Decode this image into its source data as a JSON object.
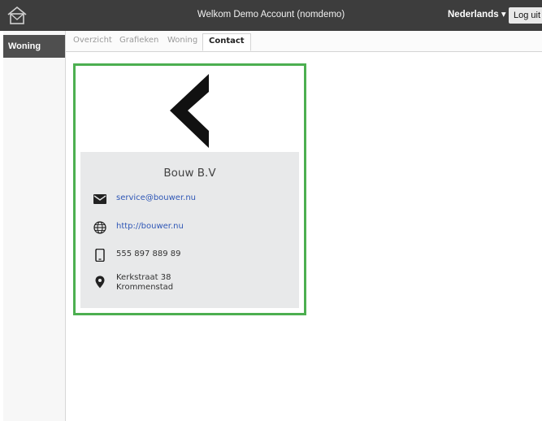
{
  "header": {
    "welcome": "Welkom Demo Account (nomdemo)",
    "language": "Nederlands ▾",
    "logout": "Log uit"
  },
  "sidebar": {
    "items": [
      {
        "label": "Woning"
      }
    ]
  },
  "tabs": [
    {
      "label": "Overzicht",
      "active": false
    },
    {
      "label": "Grafieken",
      "active": false
    },
    {
      "label": "Woning",
      "active": false
    },
    {
      "label": "Contact",
      "active": true
    }
  ],
  "contact": {
    "company": "Bouw B.V",
    "email": "service@bouwer.nu",
    "website": "http://bouwer.nu",
    "phone": "555 897 889 89",
    "address_line1": "Kerkstraat 38",
    "address_line2": "Krommenstad"
  },
  "icons": {
    "logo": "house-envelope-icon",
    "email": "envelope-icon",
    "website": "globe-icon",
    "phone": "mobile-phone-icon",
    "address": "map-pin-icon",
    "brand": "chevron-left-logo"
  },
  "colors": {
    "header_bg": "#3d3d3d",
    "card_border": "#4caf50",
    "link": "#2f57b6",
    "info_bg": "#e8e9ea"
  }
}
